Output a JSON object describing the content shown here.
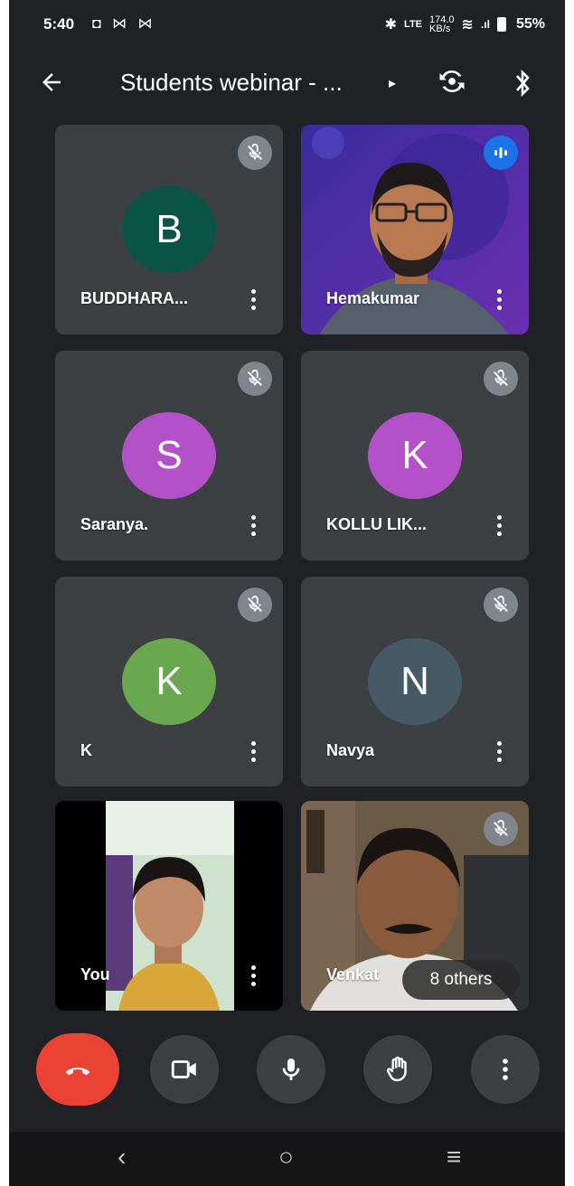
{
  "status_bar": {
    "time": "5:40",
    "left_icons": "◘ ⋈ ⋈",
    "net_speed": "174.0\nKB/s",
    "battery": "55%"
  },
  "top_bar": {
    "title": "Students webinar - ...",
    "caret": "▸"
  },
  "participants": [
    {
      "name": "BUDDHARA...",
      "initial": "B",
      "avatar_color": "#0b5345",
      "muted": true
    },
    {
      "name": "Hemakumar",
      "initial": "",
      "video": true,
      "speaking": true
    },
    {
      "name": "Saranya.",
      "initial": "S",
      "avatar_color": "#b450c8",
      "muted": true
    },
    {
      "name": "KOLLU LIK...",
      "initial": "K",
      "avatar_color": "#b450c8",
      "muted": true
    },
    {
      "name": "K",
      "initial": "K",
      "avatar_color": "#6aa84f",
      "muted": true
    },
    {
      "name": "Navya",
      "initial": "N",
      "avatar_color": "#455a64",
      "muted": true
    },
    {
      "name": "You",
      "initial": "",
      "video": true
    },
    {
      "name": "Venkat",
      "initial": "",
      "video": true,
      "muted": true
    }
  ],
  "others_label": "8 others",
  "controls": [
    "end-call-icon",
    "camera-icon",
    "mic-icon",
    "raise-hand-icon",
    "more-icon"
  ],
  "colors": {
    "end_call": "#ea4335",
    "background": "#202124",
    "tile": "#3c4043"
  }
}
